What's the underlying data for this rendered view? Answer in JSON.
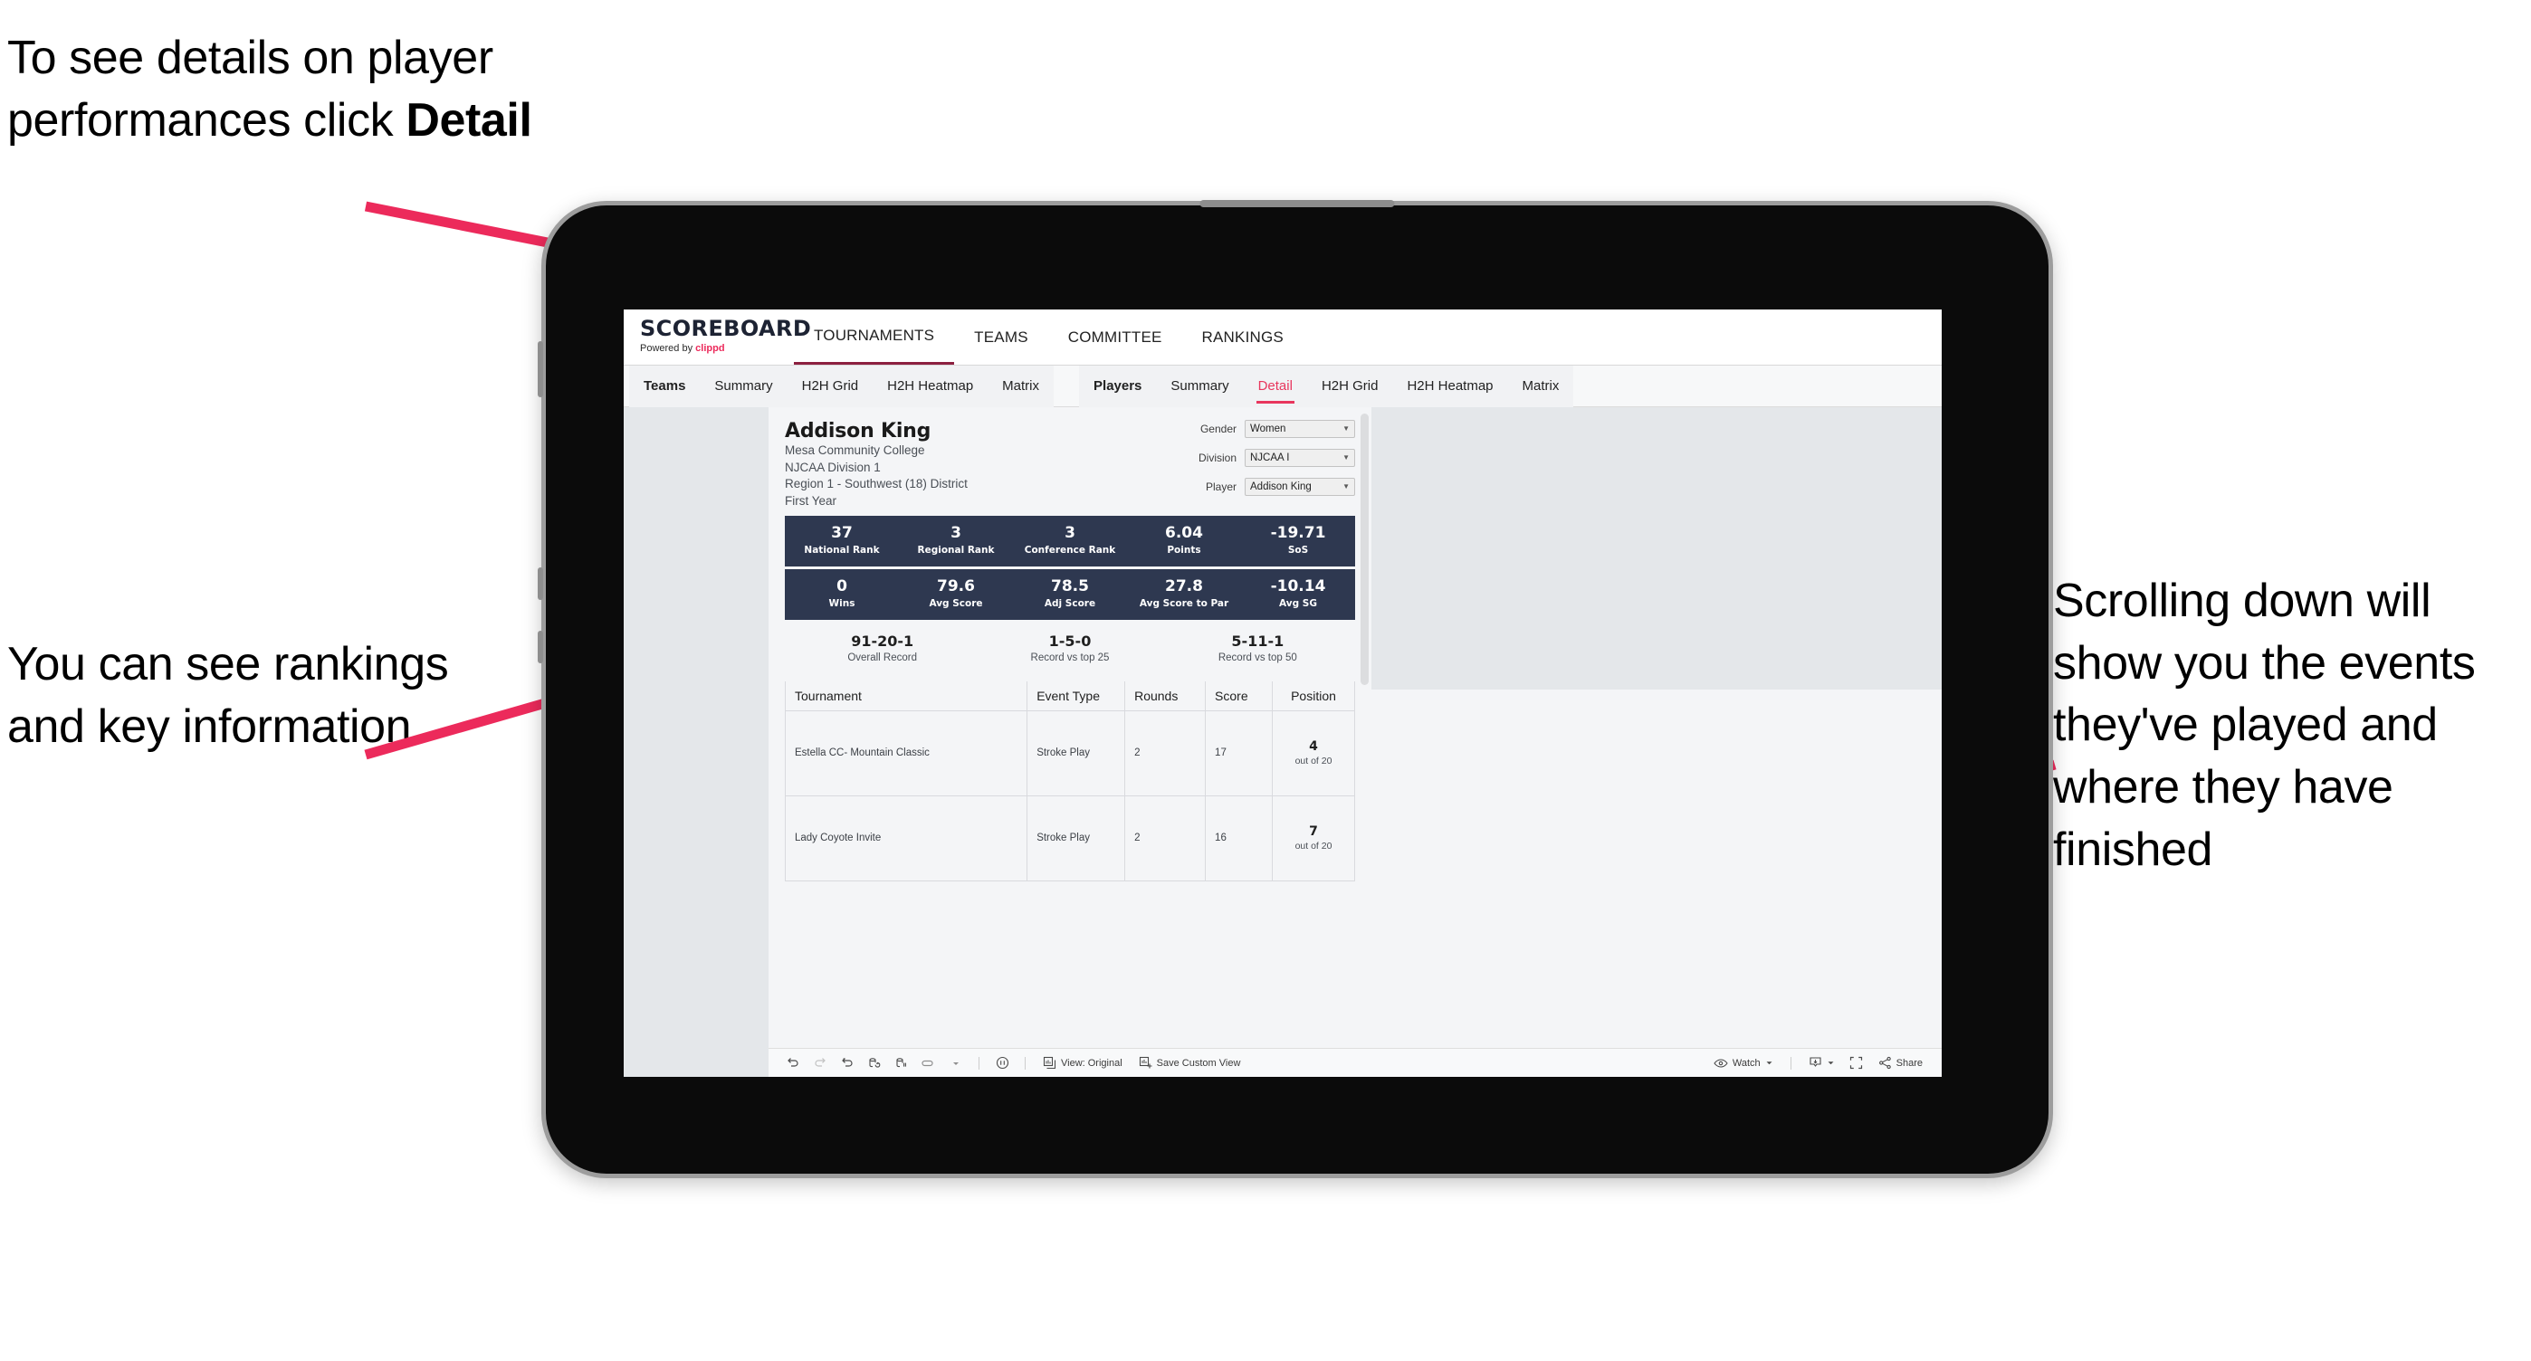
{
  "annotations": {
    "top_left": "To see details on player performances click ",
    "top_left_bold": "Detail",
    "bottom_left": "You can see rankings and key information",
    "right": "Scrolling down will show you the events they've played and where they have finished",
    "arrow_color": "#ec2a5b"
  },
  "app": {
    "brand_title": "SCOREBOARD",
    "brand_sub_prefix": "Powered by ",
    "brand_sub_name": "clippd",
    "top_nav": [
      {
        "label": "TOURNAMENTS",
        "selected": true
      },
      {
        "label": "TEAMS",
        "selected": false
      },
      {
        "label": "COMMITTEE",
        "selected": false
      },
      {
        "label": "RANKINGS",
        "selected": false
      }
    ],
    "sub_nav_group1": [
      {
        "label": "Teams",
        "bold": true,
        "active": false
      },
      {
        "label": "Summary",
        "bold": false,
        "active": false
      },
      {
        "label": "H2H Grid",
        "bold": false,
        "active": false
      },
      {
        "label": "H2H Heatmap",
        "bold": false,
        "active": false
      },
      {
        "label": "Matrix",
        "bold": false,
        "active": false
      }
    ],
    "sub_nav_group2": [
      {
        "label": "Players",
        "bold": true,
        "active": false
      },
      {
        "label": "Summary",
        "bold": false,
        "active": false
      },
      {
        "label": "Detail",
        "bold": false,
        "active": true
      },
      {
        "label": "H2H Grid",
        "bold": false,
        "active": false
      },
      {
        "label": "H2H Heatmap",
        "bold": false,
        "active": false
      },
      {
        "label": "Matrix",
        "bold": false,
        "active": false
      }
    ]
  },
  "player": {
    "name": "Addison King",
    "school": "Mesa Community College",
    "division": "NJCAA Division 1",
    "region": "Region 1 - Southwest (18) District",
    "year": "First Year"
  },
  "filters": [
    {
      "label": "Gender",
      "value": "Women"
    },
    {
      "label": "Division",
      "value": "NJCAA I"
    },
    {
      "label": "Player",
      "value": "Addison King"
    }
  ],
  "stats_band_1": [
    {
      "value": "37",
      "label": "National Rank"
    },
    {
      "value": "3",
      "label": "Regional Rank"
    },
    {
      "value": "3",
      "label": "Conference Rank"
    },
    {
      "value": "6.04",
      "label": "Points"
    },
    {
      "value": "-19.71",
      "label": "SoS"
    }
  ],
  "stats_band_2": [
    {
      "value": "0",
      "label": "Wins"
    },
    {
      "value": "79.6",
      "label": "Avg Score"
    },
    {
      "value": "78.5",
      "label": "Adj Score"
    },
    {
      "value": "27.8",
      "label": "Avg Score to Par"
    },
    {
      "value": "-10.14",
      "label": "Avg SG"
    }
  ],
  "records": [
    {
      "value": "91-20-1",
      "label": "Overall Record"
    },
    {
      "value": "1-5-0",
      "label": "Record vs top 25"
    },
    {
      "value": "5-11-1",
      "label": "Record vs top 50"
    }
  ],
  "events_table": {
    "columns": [
      "Tournament",
      "Event Type",
      "Rounds",
      "Score",
      "Position"
    ],
    "rows": [
      {
        "tournament": "Estella CC- Mountain Classic",
        "event_type": "Stroke Play",
        "rounds": "2",
        "score": "17",
        "position": "4",
        "position_of": "out of 20"
      },
      {
        "tournament": "Lady Coyote Invite",
        "event_type": "Stroke Play",
        "rounds": "2",
        "score": "16",
        "position": "7",
        "position_of": "out of 20"
      }
    ]
  },
  "toolbar": {
    "view_label": "View: Original",
    "save_label": "Save Custom View",
    "watch_label": "Watch",
    "share_label": "Share"
  },
  "colors": {
    "accent_pink": "#e8365d",
    "band_navy": "#2e3850",
    "brand_red": "#ec2a5b"
  }
}
